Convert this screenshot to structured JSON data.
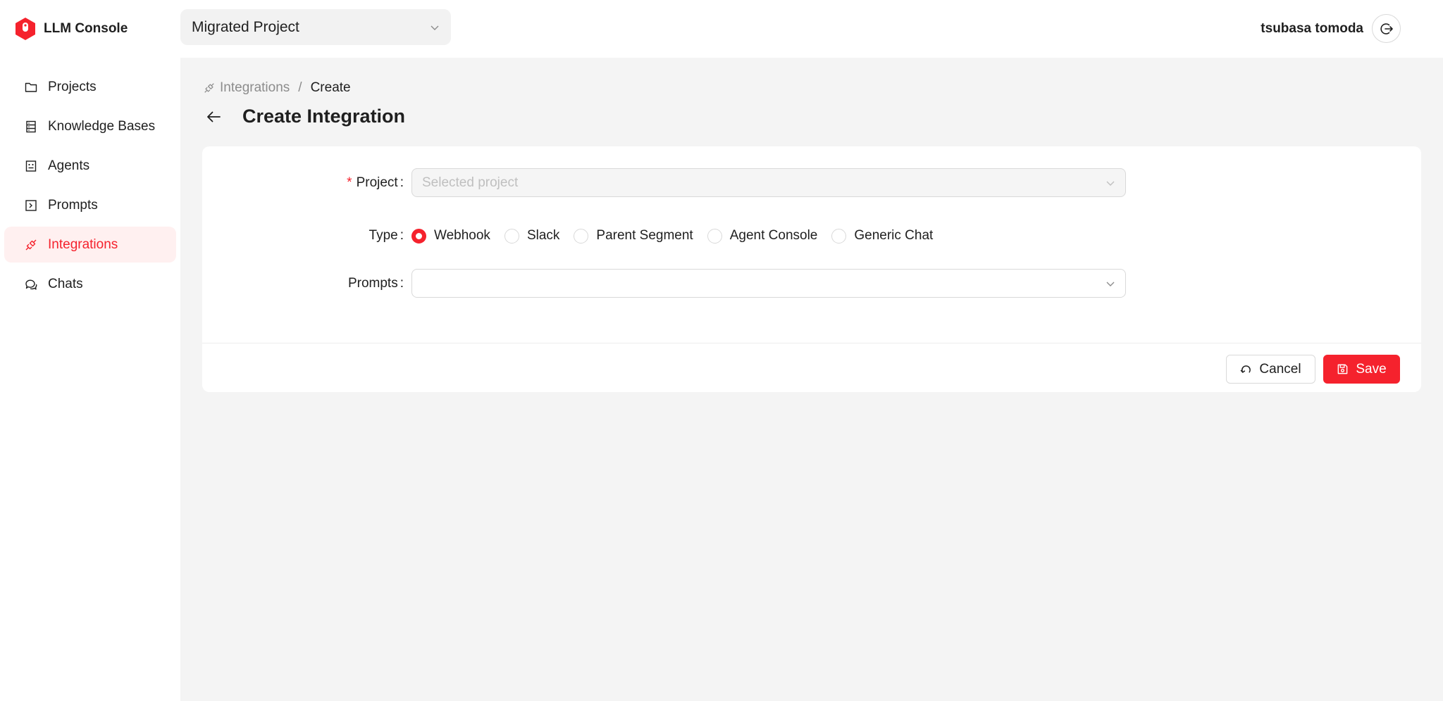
{
  "app": {
    "name": "LLM Console",
    "brand_color": "#f5222d"
  },
  "header": {
    "project_select": {
      "value": "Migrated Project",
      "icon": "chevron-down-icon"
    },
    "user": {
      "name": "tsubasa tomoda",
      "logout_icon": "logout-icon"
    }
  },
  "sidebar": {
    "items": [
      {
        "label": "Projects",
        "icon": "folder-icon",
        "active": false
      },
      {
        "label": "Knowledge Bases",
        "icon": "database-icon",
        "active": false
      },
      {
        "label": "Agents",
        "icon": "robot-icon",
        "active": false
      },
      {
        "label": "Prompts",
        "icon": "code-square-icon",
        "active": false
      },
      {
        "label": "Integrations",
        "icon": "api-icon",
        "active": true
      },
      {
        "label": "Chats",
        "icon": "comments-icon",
        "active": false
      }
    ]
  },
  "breadcrumb": {
    "parent": "Integrations",
    "separator": "/",
    "current": "Create"
  },
  "page": {
    "title": "Create Integration"
  },
  "form": {
    "project": {
      "label": "Project",
      "required_mark": "*",
      "colon": ":",
      "placeholder": "Selected project",
      "disabled": true
    },
    "type": {
      "label": "Type",
      "colon": ":",
      "options": [
        "Webhook",
        "Slack",
        "Parent Segment",
        "Agent Console",
        "Generic Chat"
      ],
      "selected": "Webhook"
    },
    "prompts": {
      "label": "Prompts",
      "colon": ":",
      "value": ""
    }
  },
  "footer": {
    "cancel_label": "Cancel",
    "save_label": "Save"
  }
}
